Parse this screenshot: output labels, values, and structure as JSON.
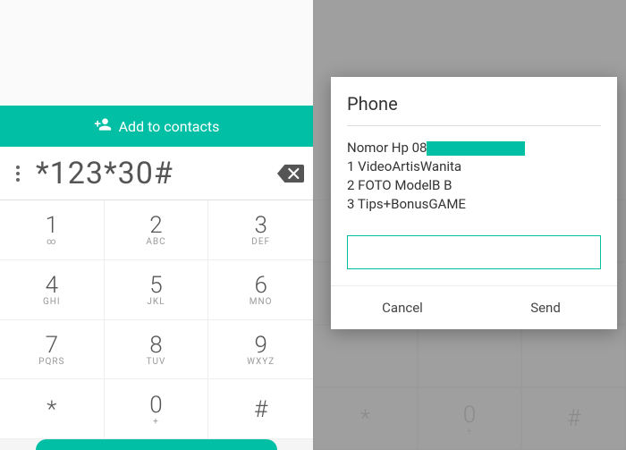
{
  "colors": {
    "accent": "#00bfa5"
  },
  "left": {
    "add_contacts_label": "Add to contacts",
    "dialed_number": "*123*30#",
    "keys": [
      {
        "digit": "1",
        "letters": "∞"
      },
      {
        "digit": "2",
        "letters": "ABC"
      },
      {
        "digit": "3",
        "letters": "DEF"
      },
      {
        "digit": "4",
        "letters": "GHI"
      },
      {
        "digit": "5",
        "letters": "JKL"
      },
      {
        "digit": "6",
        "letters": "MNO"
      },
      {
        "digit": "7",
        "letters": "PQRS"
      },
      {
        "digit": "8",
        "letters": "TUV"
      },
      {
        "digit": "9",
        "letters": "WXYZ"
      },
      {
        "digit": "*",
        "letters": ""
      },
      {
        "digit": "0",
        "letters": "+"
      },
      {
        "digit": "#",
        "letters": ""
      }
    ]
  },
  "right": {
    "bg_keys": [
      {
        "digit": "*",
        "letters": ""
      },
      {
        "digit": "0",
        "letters": "+"
      },
      {
        "digit": "#",
        "letters": ""
      }
    ],
    "dialog": {
      "title": "Phone",
      "body_prefix": "Nomor Hp 08",
      "lines": [
        "1 VideoArtisWanita",
        "2 FOTO ModelB B",
        "3 Tips+BonusGAME"
      ],
      "input_value": "",
      "cancel_label": "Cancel",
      "send_label": "Send"
    }
  }
}
